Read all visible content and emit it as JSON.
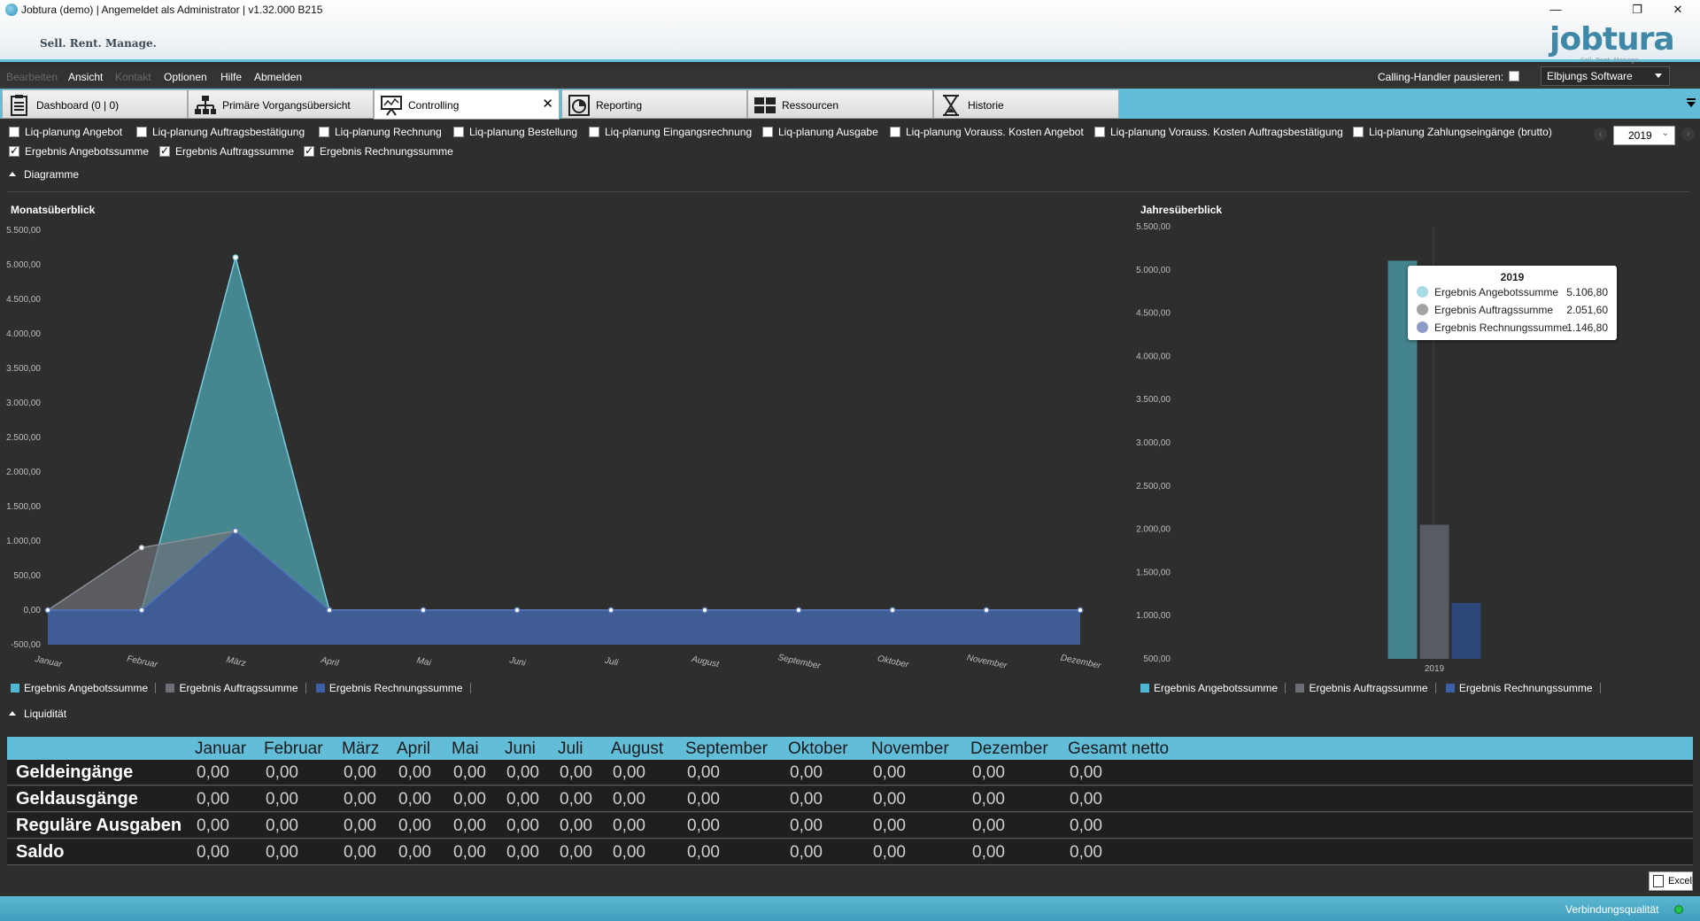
{
  "window": {
    "title": "Jobtura (demo) | Angemeldet als Administrator | v1.32.000 B215",
    "tagline": "Sell. Rent. Manage.",
    "logo_text": "jobtura",
    "logo_subtext": "Sell. Rent. Manage.",
    "minimize": "—",
    "restore": "❐",
    "close": "✕"
  },
  "menu": {
    "items": [
      {
        "label": "Bearbeiten",
        "enabled": false
      },
      {
        "label": "Ansicht",
        "enabled": true
      },
      {
        "label": "Kontakt",
        "enabled": false
      },
      {
        "label": "Optionen",
        "enabled": true
      },
      {
        "label": "Hilfe",
        "enabled": true
      },
      {
        "label": "Abmelden",
        "enabled": true
      }
    ],
    "calling_handler_label": "Calling-Handler pausieren:",
    "calling_handler_checked": false,
    "company": "Elbjungs Software"
  },
  "tabs": [
    {
      "label": "Dashboard (0 | 0)",
      "icon": "clipboard-icon",
      "active": false
    },
    {
      "label": "Primäre Vorgangsübersicht",
      "icon": "hierarchy-icon",
      "active": false
    },
    {
      "label": "Controlling",
      "icon": "presentation-chart-icon",
      "active": true
    },
    {
      "label": "Reporting",
      "icon": "report-gauge-icon",
      "active": false
    },
    {
      "label": "Ressourcen",
      "icon": "resources-icon",
      "active": false
    },
    {
      "label": "Historie",
      "icon": "hourglass-icon",
      "active": false
    }
  ],
  "tab_close": "✕",
  "filters": [
    {
      "label": "Liq-planung Angebot",
      "checked": false
    },
    {
      "label": "Liq-planung Auftragsbestätigung",
      "checked": false
    },
    {
      "label": "Liq-planung Rechnung",
      "checked": false
    },
    {
      "label": "Liq-planung Bestellung",
      "checked": false
    },
    {
      "label": "Liq-planung Eingangsrechnung",
      "checked": false
    },
    {
      "label": "Liq-planung Ausgabe",
      "checked": false
    },
    {
      "label": "Liq-planung Vorauss. Kosten Angebot",
      "checked": false
    },
    {
      "label": "Liq-planung Vorauss. Kosten Auftragsbestätigung",
      "checked": false
    },
    {
      "label": "Liq-planung Zahlungseingänge (brutto)",
      "checked": false
    },
    {
      "label": "Ergebnis Angebotssumme",
      "checked": true
    },
    {
      "label": "Ergebnis Auftragssumme",
      "checked": true
    },
    {
      "label": "Ergebnis Rechnungssumme",
      "checked": true
    }
  ],
  "year": {
    "value": "2019",
    "prev": "‹",
    "next": "›",
    "caret": "⌄"
  },
  "sections": {
    "diagramme": "Diagramme",
    "liquiditaet": "Liquidität"
  },
  "colors": {
    "angebot": "#4fa9b6",
    "auftrag": "#5d6168",
    "rechnung": "#3d5b96",
    "accent": "#62bdd8"
  },
  "chart_data": [
    {
      "type": "area",
      "title": "Monatsüberblick",
      "categories": [
        "Januar",
        "Februar",
        "März",
        "April",
        "Mai",
        "Juni",
        "Juli",
        "August",
        "September",
        "Oktober",
        "November",
        "Dezember"
      ],
      "y_ticks": [
        "5.500,00",
        "5.000,00",
        "4.500,00",
        "4.000,00",
        "3.500,00",
        "3.000,00",
        "2.500,00",
        "2.000,00",
        "1.500,00",
        "1.000,00",
        "500,00",
        "0,00",
        "-500,00"
      ],
      "ylim": [
        -500,
        5500
      ],
      "series": [
        {
          "name": "Ergebnis Angebotssumme",
          "values": [
            0,
            0,
            5106.8,
            0,
            0,
            0,
            0,
            0,
            0,
            0,
            0,
            0
          ]
        },
        {
          "name": "Ergebnis Auftragssumme",
          "values": [
            0,
            905,
            1146.8,
            0,
            0,
            0,
            0,
            0,
            0,
            0,
            0,
            0
          ]
        },
        {
          "name": "Ergebnis Rechnungssumme",
          "values": [
            0,
            0,
            1146.8,
            0,
            0,
            0,
            0,
            0,
            0,
            0,
            0,
            0
          ]
        }
      ],
      "legend_position": "bottom-left"
    },
    {
      "type": "bar",
      "title": "Jahresüberblick",
      "categories": [
        "2019"
      ],
      "y_ticks": [
        "5.500,00",
        "5.000,00",
        "4.500,00",
        "4.000,00",
        "3.500,00",
        "3.000,00",
        "2.500,00",
        "2.000,00",
        "1.500,00",
        "1.000,00",
        "500,00"
      ],
      "ylim": [
        500,
        5500
      ],
      "series": [
        {
          "name": "Ergebnis Angebotssumme",
          "values": [
            5106.8
          ]
        },
        {
          "name": "Ergebnis Auftragssumme",
          "values": [
            2051.6
          ]
        },
        {
          "name": "Ergebnis Rechnungssumme",
          "values": [
            1146.8
          ]
        }
      ],
      "legend_position": "bottom-left",
      "tooltip": {
        "title": "2019",
        "rows": [
          {
            "name": "Ergebnis Angebotssumme",
            "value": "5.106,80"
          },
          {
            "name": "Ergebnis Auftragssumme",
            "value": "2.051,60"
          },
          {
            "name": "Ergebnis Rechnungssumme",
            "value": "1.146,80"
          }
        ]
      }
    }
  ],
  "liquidity": {
    "columns": [
      "Januar",
      "Februar",
      "März",
      "April",
      "Mai",
      "Juni",
      "Juli",
      "August",
      "September",
      "Oktober",
      "November",
      "Dezember",
      "Gesamt netto"
    ],
    "rows": [
      {
        "label": "Geldeingänge",
        "values": [
          "0,00",
          "0,00",
          "0,00",
          "0,00",
          "0,00",
          "0,00",
          "0,00",
          "0,00",
          "0,00",
          "0,00",
          "0,00",
          "0,00",
          "0,00"
        ]
      },
      {
        "label": "Geldausgänge",
        "values": [
          "0,00",
          "0,00",
          "0,00",
          "0,00",
          "0,00",
          "0,00",
          "0,00",
          "0,00",
          "0,00",
          "0,00",
          "0,00",
          "0,00",
          "0,00"
        ]
      },
      {
        "label": "Reguläre Ausgaben",
        "values": [
          "0,00",
          "0,00",
          "0,00",
          "0,00",
          "0,00",
          "0,00",
          "0,00",
          "0,00",
          "0,00",
          "0,00",
          "0,00",
          "0,00",
          "0,00"
        ]
      },
      {
        "label": "Saldo",
        "values": [
          "0,00",
          "0,00",
          "0,00",
          "0,00",
          "0,00",
          "0,00",
          "0,00",
          "0,00",
          "0,00",
          "0,00",
          "0,00",
          "0,00",
          "0,00"
        ]
      }
    ]
  },
  "excel_button": "Excel",
  "status": {
    "connection_label": "Verbindungsqualität"
  }
}
